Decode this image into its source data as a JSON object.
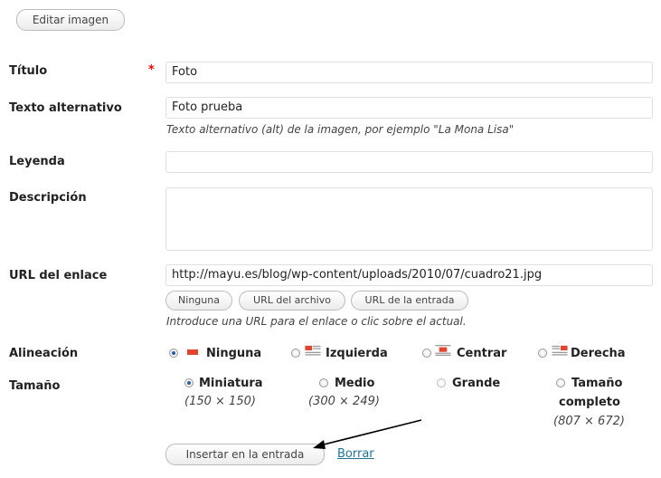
{
  "edit_image_button": "Editar imagen",
  "fields": {
    "title": {
      "label": "Título",
      "required_mark": "*",
      "value": "Foto"
    },
    "alt_text": {
      "label": "Texto alternativo",
      "value": "Foto prueba",
      "help": "Texto alternativo (alt) de la imagen, por ejemplo \"La Mona Lisa\""
    },
    "caption": {
      "label": "Leyenda",
      "value": ""
    },
    "description": {
      "label": "Descripción",
      "value": ""
    },
    "link_url": {
      "label": "URL del enlace",
      "value": "http://mayu.es/blog/wp-content/uploads/2010/07/cuadro21.jpg",
      "buttons": [
        "Ninguna",
        "URL del archivo",
        "URL de la entrada"
      ],
      "help": "Introduce una URL para el enlace o clic sobre el actual."
    }
  },
  "alignment": {
    "label": "Alineación",
    "selected": "Ninguna",
    "options": [
      "Ninguna",
      "Izquierda",
      "Centrar",
      "Derecha"
    ]
  },
  "size": {
    "label": "Tamaño",
    "selected": "Miniatura",
    "options": [
      {
        "name": "Miniatura",
        "dims": "(150 × 150)"
      },
      {
        "name": "Medio",
        "dims": "(300 × 249)"
      },
      {
        "name": "Grande",
        "dims": ""
      },
      {
        "name_line1": "Tamaño",
        "name_line2": "completo",
        "dims": "(807 × 672)"
      }
    ]
  },
  "actions": {
    "insert": "Insertar en la entrada",
    "delete": "Borrar"
  },
  "colors": {
    "accent": "#2a5da8",
    "link": "#21759b",
    "required": "#ff0000",
    "align_icon": "#e1452d"
  },
  "icons": [
    "align-none-icon",
    "align-left-icon",
    "align-center-icon",
    "align-right-icon",
    "arrow-annotation"
  ]
}
